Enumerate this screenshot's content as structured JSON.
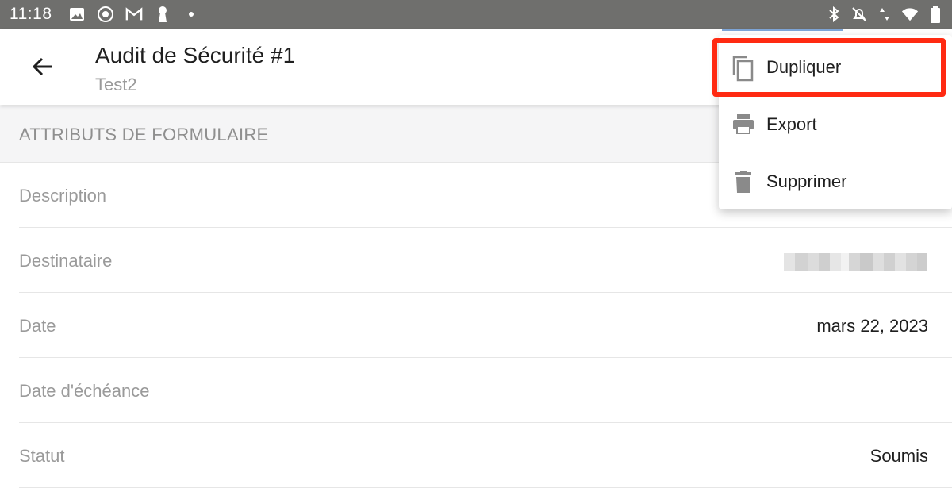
{
  "status_bar": {
    "time": "11:18",
    "left_icons": [
      "image-icon",
      "vpn-globe-icon",
      "gmail-icon",
      "keyhole-icon",
      "notification-dot-icon"
    ],
    "right_icons": [
      "bluetooth-icon",
      "bell-off-icon",
      "data-arrows-icon",
      "wifi-icon",
      "battery-icon"
    ]
  },
  "app_bar": {
    "title": "Audit de Sécurité #1",
    "subtitle": "Test2"
  },
  "section": {
    "header": "ATTRIBUTS DE FORMULAIRE"
  },
  "rows": [
    {
      "label": "Description",
      "value": ""
    },
    {
      "label": "Destinataire",
      "value": ""
    },
    {
      "label": "Date",
      "value": "mars 22, 2023"
    },
    {
      "label": "Date d'échéance",
      "value": ""
    },
    {
      "label": "Statut",
      "value": "Soumis"
    }
  ],
  "menu": {
    "items": [
      {
        "label": "Dupliquer",
        "icon": "copy-icon"
      },
      {
        "label": "Export",
        "icon": "printer-icon"
      },
      {
        "label": "Supprimer",
        "icon": "trash-icon"
      }
    ]
  },
  "colors": {
    "status_bar": "#6f6f6d",
    "highlight": "#ff2a12",
    "label_gray": "#9a9a9a",
    "section_bg": "#f5f5f6"
  }
}
